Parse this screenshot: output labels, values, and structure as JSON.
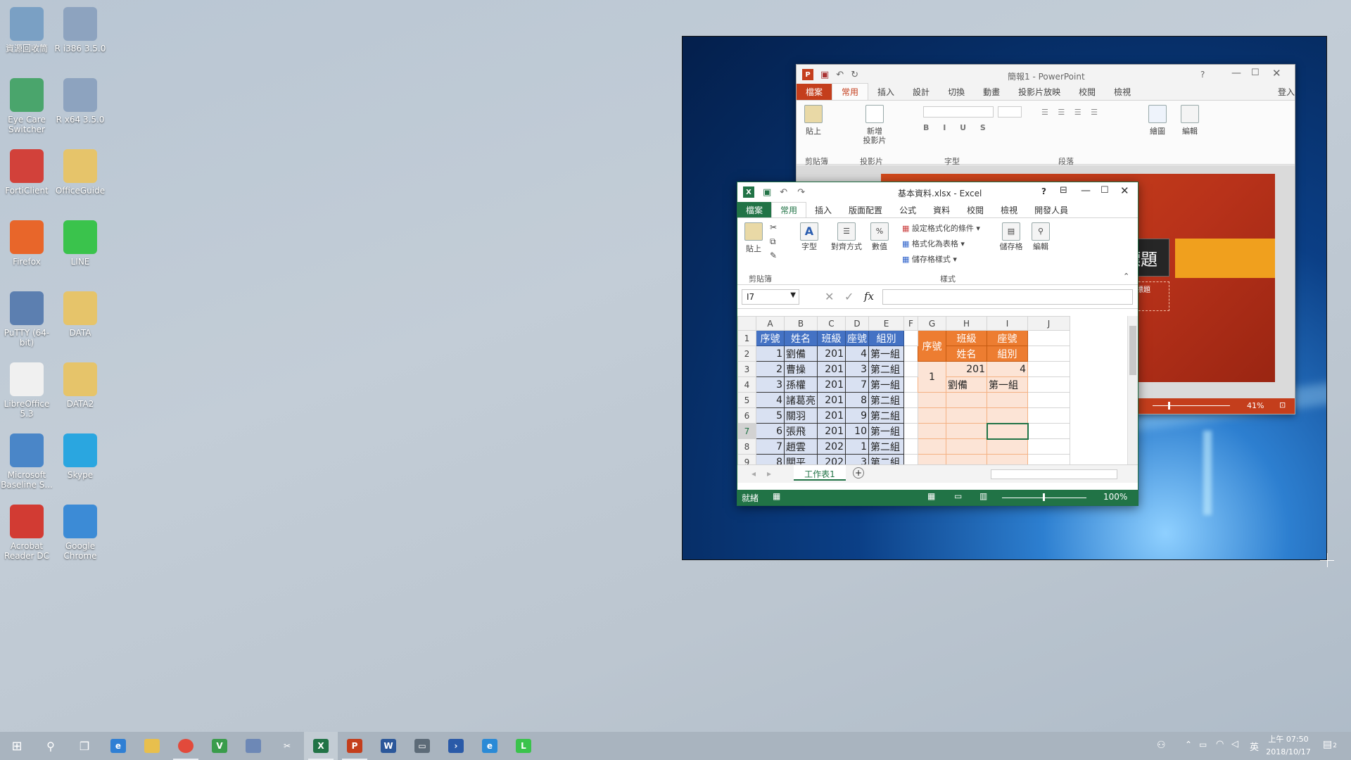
{
  "desktop": {
    "icons": [
      {
        "label": "資源回收筒",
        "icon": "recycle-bin-icon",
        "color": "#7aa0c4"
      },
      {
        "label": "R i386 3.5.0",
        "icon": "r-icon",
        "color": "#8da3bf"
      },
      {
        "label": "Eye Care Switcher",
        "icon": "eye-care-icon",
        "color": "#4aa56c"
      },
      {
        "label": "R x64 3.5.0",
        "icon": "r-icon",
        "color": "#8da3bf"
      },
      {
        "label": "FortiClient",
        "icon": "shield-icon",
        "color": "#d2413a"
      },
      {
        "label": "OfficeGuide",
        "icon": "folder-icon",
        "color": "#e6c46a"
      },
      {
        "label": "Firefox",
        "icon": "firefox-icon",
        "color": "#e8662a"
      },
      {
        "label": "LINE",
        "icon": "line-icon",
        "color": "#3ac34c"
      },
      {
        "label": "PuTTY (64-bit)",
        "icon": "putty-icon",
        "color": "#5c7fb0"
      },
      {
        "label": "DATA",
        "icon": "folder-icon",
        "color": "#e6c46a"
      },
      {
        "label": "LibreOffice 5.3",
        "icon": "document-icon",
        "color": "#f0f0f0"
      },
      {
        "label": "DATA2",
        "icon": "folder-icon",
        "color": "#e6c46a"
      },
      {
        "label": "Microsoft Baseline S...",
        "icon": "lock-icon",
        "color": "#4a86c8"
      },
      {
        "label": "Skype",
        "icon": "skype-icon",
        "color": "#2aa6e0"
      },
      {
        "label": "Acrobat Reader DC",
        "icon": "acrobat-icon",
        "color": "#d23b33"
      },
      {
        "label": "Google Chrome",
        "icon": "chrome-icon",
        "color": "#3c8bd6"
      }
    ]
  },
  "powerpoint": {
    "title": "簡報1 - PowerPoint",
    "help": "?",
    "signin": "登入",
    "tabs": [
      "檔案",
      "常用",
      "插入",
      "設計",
      "切換",
      "動畫",
      "投影片放映",
      "校閱",
      "檢視"
    ],
    "active_tab": "常用",
    "groups": [
      "剪貼簿",
      "投影片",
      "字型",
      "段落"
    ],
    "paste_label": "貼上",
    "new_slide_label": "新增\n投影片",
    "drawing_label": "繪圖",
    "editing_label": "編輯",
    "slide_title": "標題",
    "slide_subtitle": "增副標題",
    "zoom": "41%",
    "accent": "#c43e1c"
  },
  "excel": {
    "title": "基本資料.xlsx - Excel",
    "help": "?",
    "tabs": [
      "檔案",
      "常用",
      "插入",
      "版面配置",
      "公式",
      "資料",
      "校閱",
      "檢視",
      "開發人員"
    ],
    "active_tab": "常用",
    "ribbon": {
      "paste": "貼上",
      "font": "字型",
      "alignment": "對齊方式",
      "number": "數值",
      "conditional": "設定格式化的條件",
      "format_table": "格式化為表格",
      "cell_styles": "儲存格樣式",
      "cells": "儲存格",
      "editing": "編輯",
      "group_clipboard": "剪貼簿",
      "group_styles": "樣式"
    },
    "namebox": "I7",
    "fx": "fx",
    "columns": [
      "A",
      "B",
      "C",
      "D",
      "E",
      "F",
      "G",
      "H",
      "I",
      "J"
    ],
    "rows": [
      "1",
      "2",
      "3",
      "4",
      "5",
      "6",
      "7",
      "8",
      "9"
    ],
    "header": [
      "序號",
      "姓名",
      "班級",
      "座號",
      "組別"
    ],
    "data": [
      [
        "1",
        "劉備",
        "201",
        "4",
        "第一組"
      ],
      [
        "2",
        "曹操",
        "201",
        "3",
        "第二組"
      ],
      [
        "3",
        "孫權",
        "201",
        "7",
        "第一組"
      ],
      [
        "4",
        "諸葛亮",
        "201",
        "8",
        "第二組"
      ],
      [
        "5",
        "關羽",
        "201",
        "9",
        "第二組"
      ],
      [
        "6",
        "張飛",
        "201",
        "10",
        "第一組"
      ],
      [
        "7",
        "趙雲",
        "202",
        "1",
        "第二組"
      ],
      [
        "8",
        "關平",
        "202",
        "3",
        "第二組"
      ]
    ],
    "card": {
      "seq_label": "序號",
      "class_label": "班級",
      "seat_label": "座號",
      "name_label": "姓名",
      "group_label": "組別",
      "seq": "1",
      "class": "201",
      "seat": "4",
      "name": "劉備",
      "group": "第一組"
    },
    "sheet_tab": "工作表1",
    "status_ready": "就緒",
    "zoom": "100%",
    "accent": "#217346"
  },
  "taskbar": {
    "clock_time": "上午 07:50",
    "clock_date": "2018/10/17",
    "ime": "英",
    "notification_count": "2"
  }
}
